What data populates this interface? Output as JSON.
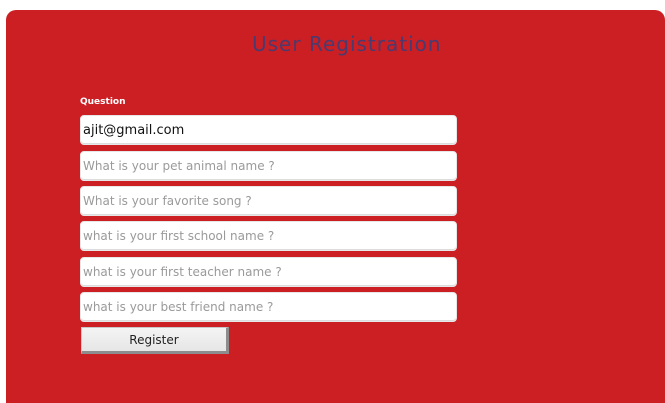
{
  "form": {
    "title": "User Registration",
    "question_label": "Question",
    "email_value": "ajit@gmail.com",
    "questions": [
      "What is your pet animal name ?",
      "What is your favorite song ?",
      "what is your first school name ?",
      "what is your first teacher name ?",
      "what is your best friend name ?"
    ],
    "register_label": "Register"
  },
  "colors": {
    "panel_background": "#cc1f24",
    "title_text": "#4a3a6e",
    "label_text": "#ffffff",
    "placeholder_text": "#9a9a9a"
  }
}
